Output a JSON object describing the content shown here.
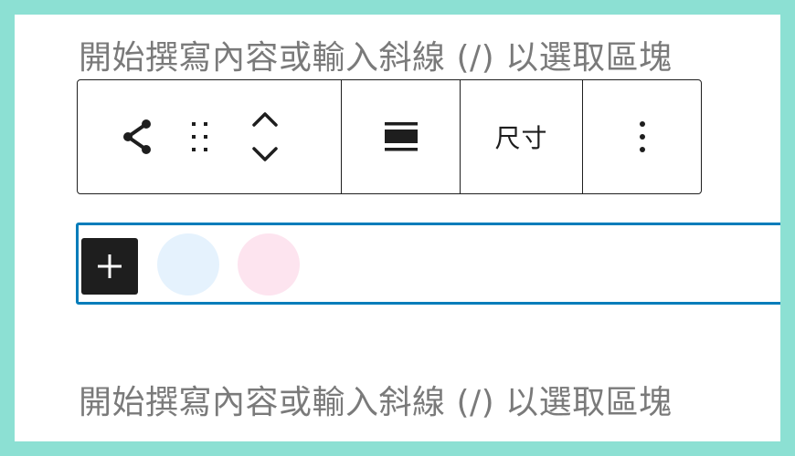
{
  "editor": {
    "placeholder_top": "開始撰寫內容或輸入斜線 (/) 以選取區塊",
    "placeholder_bottom": "開始撰寫內容或輸入斜線 (/) 以選取區塊"
  },
  "toolbar": {
    "select_parent_icon": "share-parent-icon",
    "drag_icon": "drag-handle-icon",
    "move_up_icon": "chevron-up-icon",
    "move_down_icon": "chevron-down-icon",
    "align_icon": "align-full-width-icon",
    "size_label": "尺寸",
    "more_icon": "more-vertical-icon"
  },
  "block": {
    "add_icon": "plus-icon",
    "swatches": [
      {
        "color": "#e5f2fd"
      },
      {
        "color": "#fde4ef"
      }
    ],
    "border_color": "#007cba"
  },
  "colors": {
    "background": "#8ce0d3",
    "canvas": "#ffffff",
    "placeholder": "#7a7a7a",
    "ink": "#1e1e1e",
    "accent": "#007cba"
  }
}
